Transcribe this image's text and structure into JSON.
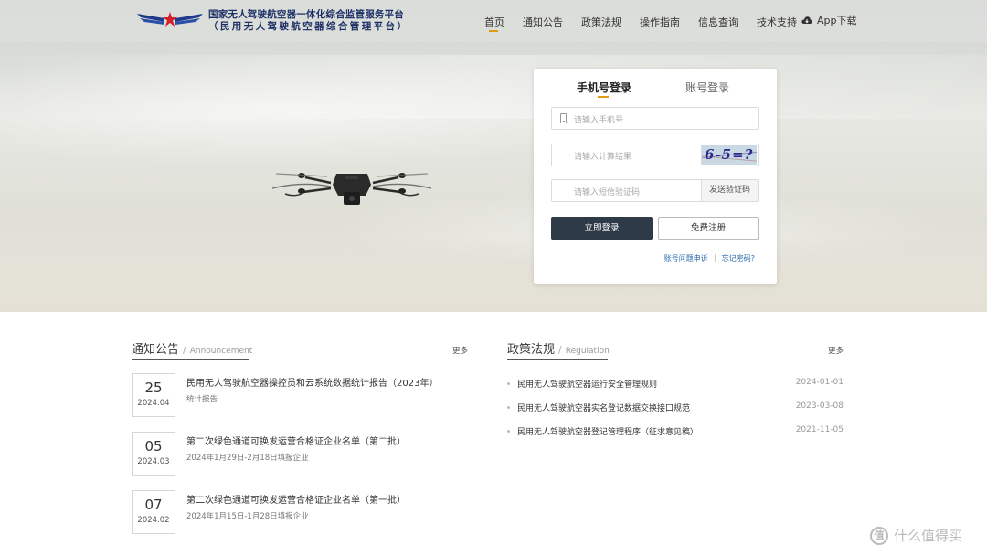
{
  "header": {
    "title_line1": "国家无人驾驶航空器一体化综合监管服务平台",
    "title_line2": "（民用无人驾驶航空器综合管理平台）",
    "nav": [
      "首页",
      "通知公告",
      "政策法规",
      "操作指南",
      "信息查询",
      "技术支持"
    ],
    "active_nav": "首页",
    "app_download": "App下载"
  },
  "login": {
    "tab_phone": "手机号登录",
    "tab_account": "账号登录",
    "phone_placeholder": "请输入手机号",
    "calc_placeholder": "请输入计算结果",
    "captcha_text": "6-5=?",
    "sms_placeholder": "请输入短信验证码",
    "send_code": "发送验证码",
    "login_btn": "立即登录",
    "register_btn": "免费注册",
    "account_issue": "账号问题申诉",
    "forgot": "忘记密码?"
  },
  "notices": {
    "title": "通知公告",
    "title_en": "Announcement",
    "more": "更多",
    "items": [
      {
        "day": "25",
        "ym": "2024.04",
        "title": "民用无人驾驶航空器操控员和云系统数据统计报告（2023年）",
        "sub": "统计报告"
      },
      {
        "day": "05",
        "ym": "2024.03",
        "title": "第二次绿色通道可换发运营合格证企业名单（第二批）",
        "sub": "2024年1月29日-2月18日填报企业"
      },
      {
        "day": "07",
        "ym": "2024.02",
        "title": "第二次绿色通道可换发运营合格证企业名单（第一批）",
        "sub": "2024年1月15日-1月28日填报企业"
      }
    ]
  },
  "policies": {
    "title": "政策法规",
    "title_en": "Regulation",
    "more": "更多",
    "items": [
      {
        "title": "民用无人驾驶航空器运行安全管理规则",
        "date": "2024-01-01"
      },
      {
        "title": "民用无人驾驶航空器实名登记数据交换接口规范",
        "date": "2023-03-08"
      },
      {
        "title": "民用无人驾驶航空器登记管理程序（征求意见稿）",
        "date": "2021-11-05"
      }
    ]
  },
  "watermark": {
    "icon": "值",
    "text": "什么值得买"
  },
  "colors": {
    "accent": "#e59a17",
    "title_navy": "#1c2f66",
    "login_button": "#2f3a48",
    "link": "#2a6ab0"
  }
}
